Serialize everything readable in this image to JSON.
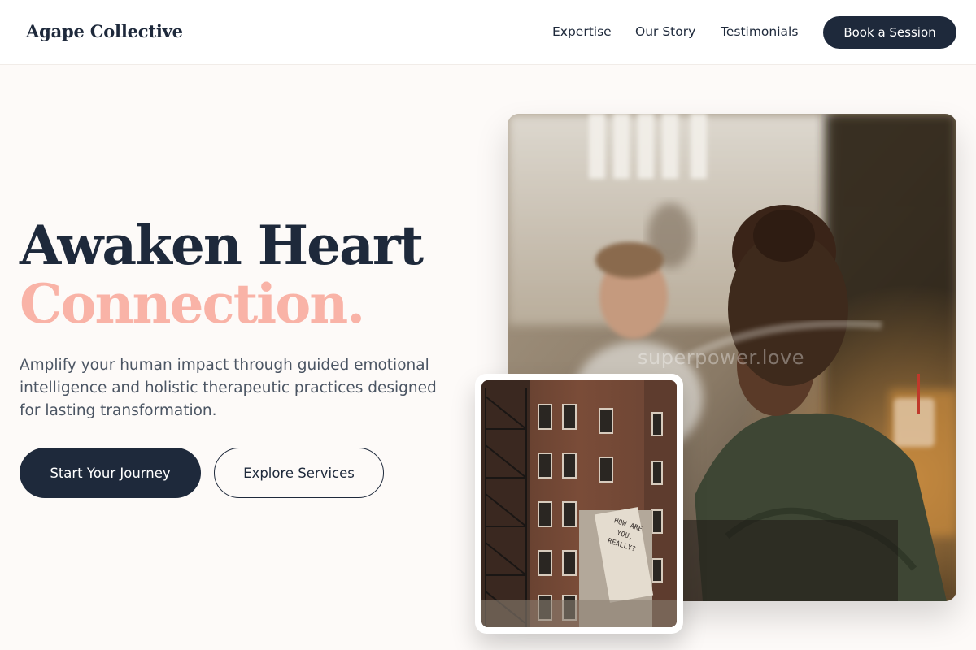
{
  "header": {
    "brand": "Agape Collective",
    "nav": {
      "expertise": "Expertise",
      "story": "Our Story",
      "testimonials": "Testimonials"
    },
    "cta": "Book a Session"
  },
  "hero": {
    "headline_line1": "Awaken Heart",
    "headline_line2": "Connection.",
    "subtext": "Amplify your human impact through guided emotional intelligence and holistic therapeutic practices designed for lasting transformation.",
    "primary_button": "Start Your Journey",
    "secondary_button": "Explore Services"
  },
  "images": {
    "main_watermark": "superpower.love",
    "small_sign": "HOW ARE YOU, REALLY?"
  },
  "colors": {
    "navy": "#1e293b",
    "peach": "#f9b3a7",
    "background": "#fdfaf8"
  }
}
